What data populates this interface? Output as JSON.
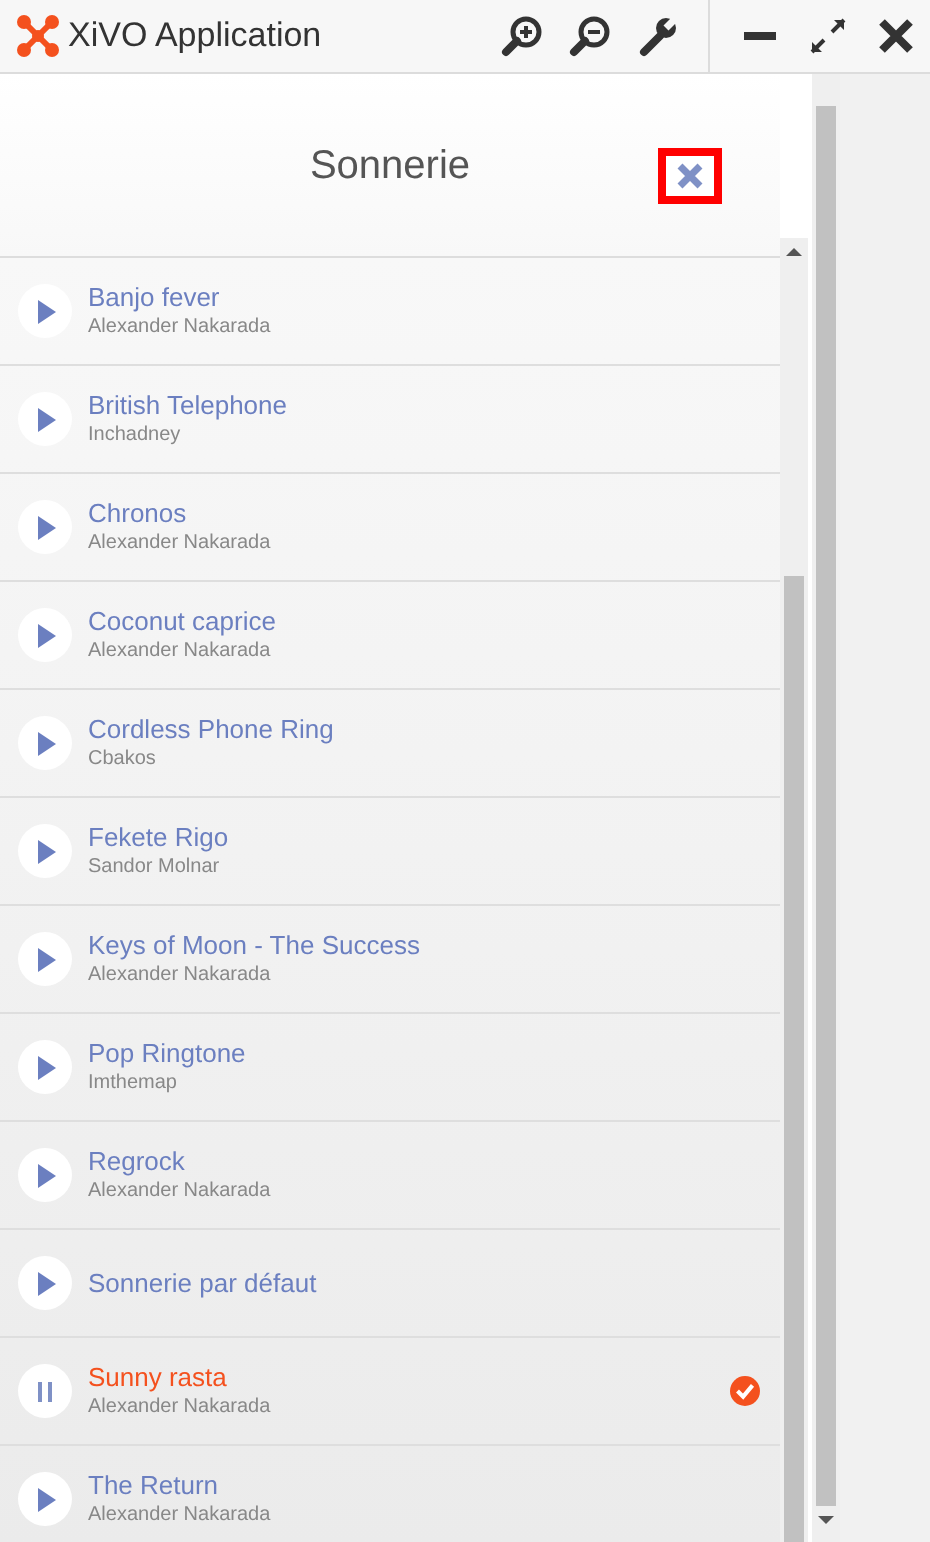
{
  "window": {
    "title": "XiVO Application"
  },
  "dialog": {
    "title": "Sonnerie"
  },
  "ringtones": [
    {
      "name": "Banjo fever",
      "author": "Alexander Nakarada",
      "playing": false,
      "selected": false
    },
    {
      "name": "British Telephone",
      "author": "Inchadney",
      "playing": false,
      "selected": false
    },
    {
      "name": "Chronos",
      "author": "Alexander Nakarada",
      "playing": false,
      "selected": false
    },
    {
      "name": "Coconut caprice",
      "author": "Alexander Nakarada",
      "playing": false,
      "selected": false
    },
    {
      "name": "Cordless Phone Ring",
      "author": "Cbakos",
      "playing": false,
      "selected": false
    },
    {
      "name": "Fekete Rigo",
      "author": "Sandor Molnar",
      "playing": false,
      "selected": false
    },
    {
      "name": "Keys of Moon - The Success",
      "author": "Alexander Nakarada",
      "playing": false,
      "selected": false
    },
    {
      "name": "Pop Ringtone",
      "author": "Imthemap",
      "playing": false,
      "selected": false
    },
    {
      "name": "Regrock",
      "author": "Alexander Nakarada",
      "playing": false,
      "selected": false
    },
    {
      "name": "Sonnerie par défaut",
      "playing": false,
      "selected": false
    },
    {
      "name": "Sunny rasta",
      "author": "Alexander Nakarada",
      "playing": true,
      "selected": true
    },
    {
      "name": "The Return",
      "author": "Alexander Nakarada",
      "playing": false,
      "selected": false
    }
  ]
}
